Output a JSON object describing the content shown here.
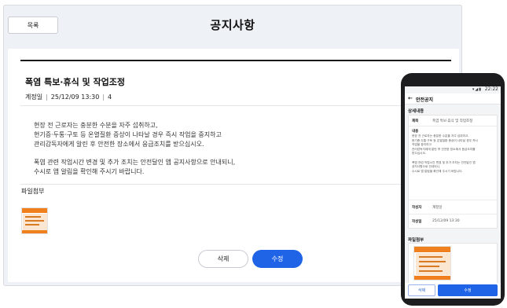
{
  "desktop": {
    "back_label": "목록",
    "page_title": "공지사항",
    "post": {
      "title": "폭염 특보·휴식 및 작업조정",
      "author": "계정일",
      "date": "25/12/09 13:30",
      "views": "4",
      "body": [
        "현장 전 근로자는 충분한 수분을 자주 섭취하고,",
        "현기증·두통·구토 등 온열질환 증상이 나타날 경우 즉시 작업을 중지하고",
        "관리감독자에게 알린 후 안전한 장소에서 응급조치를 받으십시오.",
        "폭염 관련 작업시간 변경 및 추가 조치는 안전달인 앱 공지사항으로 안내되니,",
        "수시로 앱 알림을 확인해 주시기 바랍니다."
      ]
    },
    "attachment_label": "파일첨부",
    "delete_label": "삭제",
    "edit_label": "수정"
  },
  "phone": {
    "time": "22:22",
    "app_title": "안전공지",
    "detail_header": "상세내용",
    "subject_key": "제목",
    "subject_value": "폭염 특보·휴식 및 작업조정",
    "content_key": "내용",
    "content_lines": [
      "현장 전 근로자는 충분한 수분을 자주 섭취하고,",
      "현기증·두통·구토 등 온열질환 증상이 나타날 경우 즉시",
      "작업을 중지하고",
      "관리감독자에게 알린 후 안전한 장소에서 응급조치를",
      "받으십시오.",
      "",
      "폭염 관련 작업시간 변경 및 추가 조치는 안전달인 앱",
      "공지사항으로 안내되니,",
      "수시로 앱 알림을 확인해 주시기 바랍니다."
    ],
    "author_key": "작성자",
    "author_value": "계정일",
    "date_key": "작성일",
    "date_value": "25/12/09 13:30",
    "attachment_header": "파일첨부",
    "delete_label": "삭제",
    "edit_label": "수정"
  },
  "colors": {
    "primary": "#1f63e6",
    "attachment_accent": "#f07f1d"
  }
}
